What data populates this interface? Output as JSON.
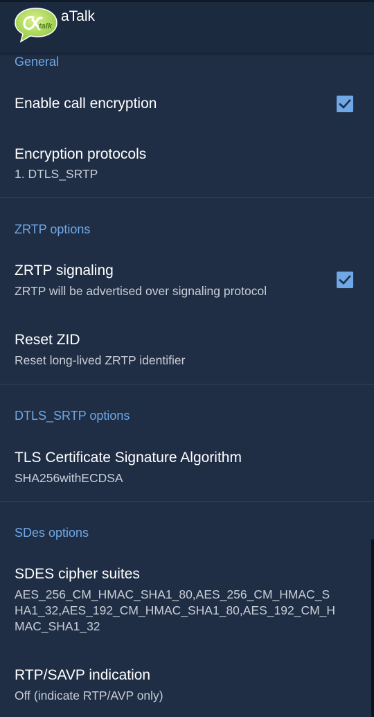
{
  "app": {
    "title": "aTalk",
    "logo_text": "talk"
  },
  "colors": {
    "accent": "#6fa8e6",
    "background": "#1f2e45",
    "appbar": "#1c2a40"
  },
  "sections": {
    "general": {
      "header": "General",
      "enable_encryption": {
        "title": "Enable call encryption",
        "checked": true
      },
      "encryption_protocols": {
        "title": "Encryption protocols",
        "summary": "1. DTLS_SRTP"
      }
    },
    "zrtp": {
      "header": "ZRTP options",
      "signaling": {
        "title": "ZRTP signaling",
        "summary": "ZRTP will be advertised over signaling protocol",
        "checked": true
      },
      "reset_zid": {
        "title": "Reset ZID",
        "summary": "Reset long-lived ZRTP identifier"
      }
    },
    "dtls": {
      "header": "DTLS_SRTP options",
      "tls_algorithm": {
        "title": "TLS Certificate Signature Algorithm",
        "summary": "SHA256withECDSA"
      }
    },
    "sdes": {
      "header": "SDes options",
      "cipher_suites": {
        "title": "SDES cipher suites",
        "summary_lines": [
          "AES_256_CM_HMAC_SHA1_80,AES_256_CM_HMAC_S",
          "HA1_32,AES_192_CM_HMAC_SHA1_80,AES_192_CM_H",
          "MAC_SHA1_32"
        ]
      },
      "rtp_savp": {
        "title": "RTP/SAVP indication",
        "summary": "Off (indicate RTP/AVP only)"
      }
    }
  }
}
